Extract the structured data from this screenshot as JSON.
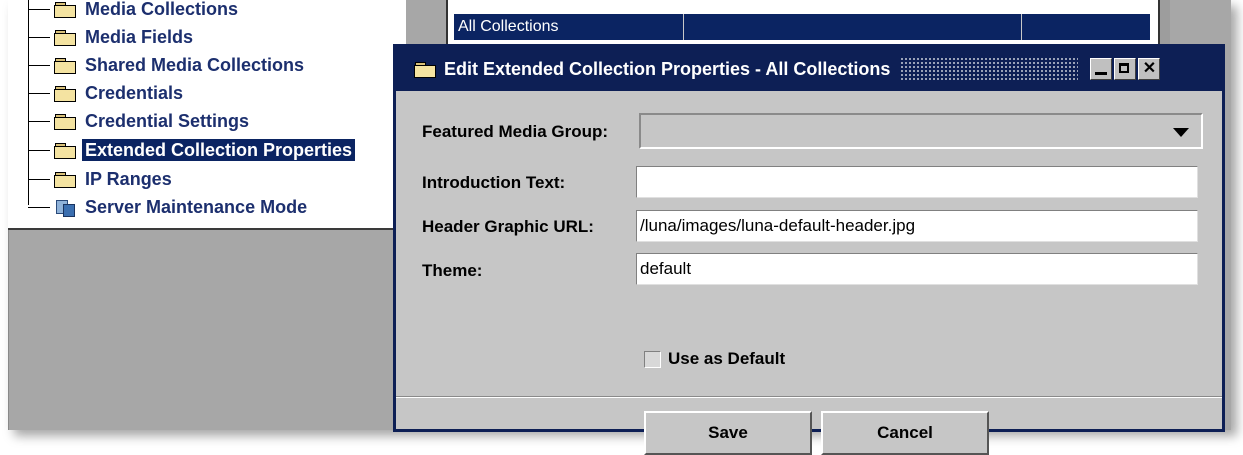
{
  "tree": {
    "items": [
      {
        "label": "Media Collections",
        "icon": "folder-icon",
        "selected": false
      },
      {
        "label": "Media Fields",
        "icon": "folder-icon",
        "selected": false
      },
      {
        "label": "Shared Media Collections",
        "icon": "folder-icon",
        "selected": false
      },
      {
        "label": "Credentials",
        "icon": "folder-icon",
        "selected": false
      },
      {
        "label": "Credential Settings",
        "icon": "folder-icon",
        "selected": false
      },
      {
        "label": "Extended Collection Properties",
        "icon": "folder-icon",
        "selected": true
      },
      {
        "label": "IP Ranges",
        "icon": "folder-icon",
        "selected": false
      },
      {
        "label": "Server Maintenance Mode",
        "icon": "server-icon",
        "selected": false
      }
    ]
  },
  "table": {
    "selected_row": {
      "name": "All Collections"
    }
  },
  "dialog": {
    "title": "Edit Extended Collection Properties - All Collections",
    "fields": {
      "featured_media_group": {
        "label": "Featured Media Group:",
        "value": ""
      },
      "introduction_text": {
        "label": "Introduction Text:",
        "value": ""
      },
      "header_graphic_url": {
        "label": "Header Graphic URL:",
        "value": "/luna/images/luna-default-header.jpg"
      },
      "theme": {
        "label": "Theme:",
        "value": "default"
      }
    },
    "use_as_default": {
      "label": "Use as Default",
      "checked": false
    },
    "buttons": {
      "save": "Save",
      "cancel": "Cancel"
    }
  },
  "colors": {
    "selection": "#0b2462",
    "dialog_frame": "#0d1f55",
    "panel": "#c6c6c6",
    "tree_text": "#1c2f6e"
  }
}
